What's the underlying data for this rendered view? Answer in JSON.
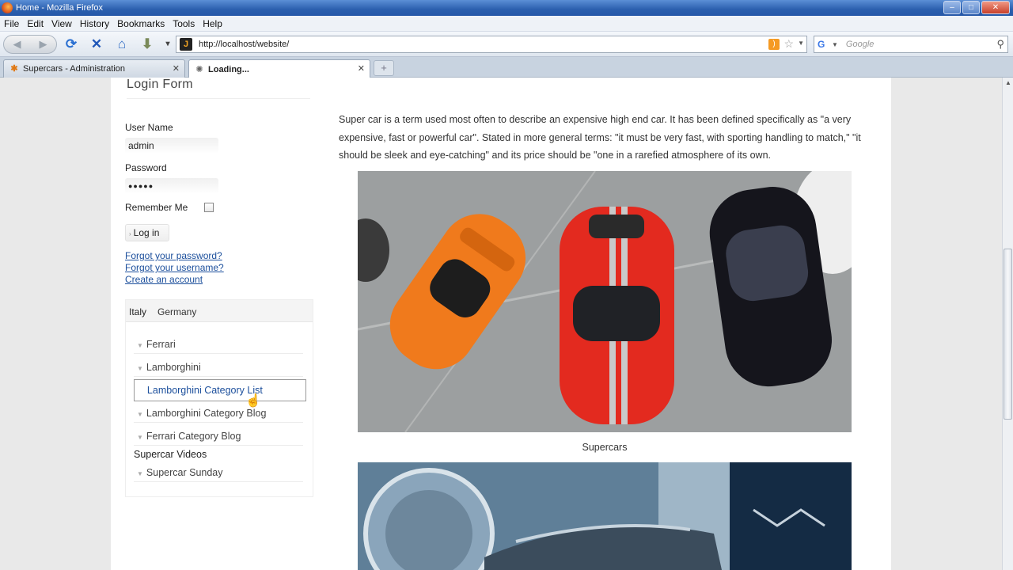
{
  "window": {
    "title": "Home - Mozilla Firefox",
    "buttons": {
      "min": "–",
      "max": "□",
      "close": "✕"
    }
  },
  "menu": [
    "File",
    "Edit",
    "View",
    "History",
    "Bookmarks",
    "Tools",
    "Help"
  ],
  "nav": {
    "back_fwd": {
      "back": "◀",
      "fwd": "▶"
    },
    "reload": "⟳",
    "stop": "✕",
    "home": "⌂",
    "download": "⬇",
    "dropdown": "▾",
    "url": "http://localhost/website/",
    "search_placeholder": "Google"
  },
  "tabs": [
    {
      "label": "Supercars - Administration",
      "close": "✕"
    },
    {
      "label": "Loading...",
      "close": "✕"
    }
  ],
  "new_tab": "+",
  "login": {
    "title": "Login Form",
    "username_label": "User Name",
    "username_value": "admin",
    "password_label": "Password",
    "password_value": "●●●●●",
    "remember_label": "Remember Me",
    "login_button": "Log in",
    "links": [
      "Forgot your password?",
      "Forgot your username?",
      "Create an account"
    ]
  },
  "module_tabs": [
    "Italy",
    "Germany"
  ],
  "menu_items": [
    "Ferrari",
    "Lamborghini",
    "Lamborghini Category List",
    "Lamborghini Category Blog",
    "Ferrari Category Blog"
  ],
  "menu_heading": "Supercar Videos",
  "menu_items_2": [
    "Supercar Sunday"
  ],
  "article": {
    "intro": "Super car is a term used most often to describe an expensive high end car. It has been defined specifically as \"a very expensive, fast or powerful car\". Stated in more general terms: \"it must be very fast, with sporting handling to match,\" \"it should be sleek and eye-catching\" and its price should be \"one in a rarefied atmosphere of its own.",
    "caption": "Supercars"
  }
}
